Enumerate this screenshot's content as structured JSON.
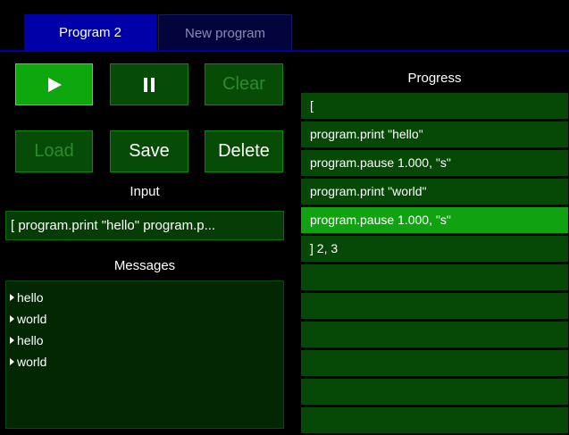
{
  "tabs": [
    {
      "label": "Program 2",
      "active": true
    },
    {
      "label": "New program",
      "active": false
    }
  ],
  "toolbar": {
    "play_icon": "play-icon",
    "pause_icon": "pause-icon",
    "clear_label": "Clear",
    "load_label": "Load",
    "save_label": "Save",
    "delete_label": "Delete"
  },
  "input": {
    "label": "Input",
    "value": "[ program.print \"hello\" program.p..."
  },
  "messages": {
    "label": "Messages",
    "items": [
      "hello",
      "world",
      "hello",
      "world"
    ]
  },
  "progress": {
    "label": "Progress",
    "rows": [
      "[",
      "program.print \"hello\"",
      "program.pause 1.000, \"s\"",
      "program.print \"world\"",
      "program.pause 1.000, \"s\"",
      "] 2, 3",
      "",
      "",
      "",
      "",
      "",
      ""
    ],
    "highlighted_index": 4
  },
  "colors": {
    "tab_active": "#0000a8",
    "button": "#064b06",
    "button_play": "#0ea80e",
    "row": "#064906",
    "row_highlight": "#10a210"
  }
}
